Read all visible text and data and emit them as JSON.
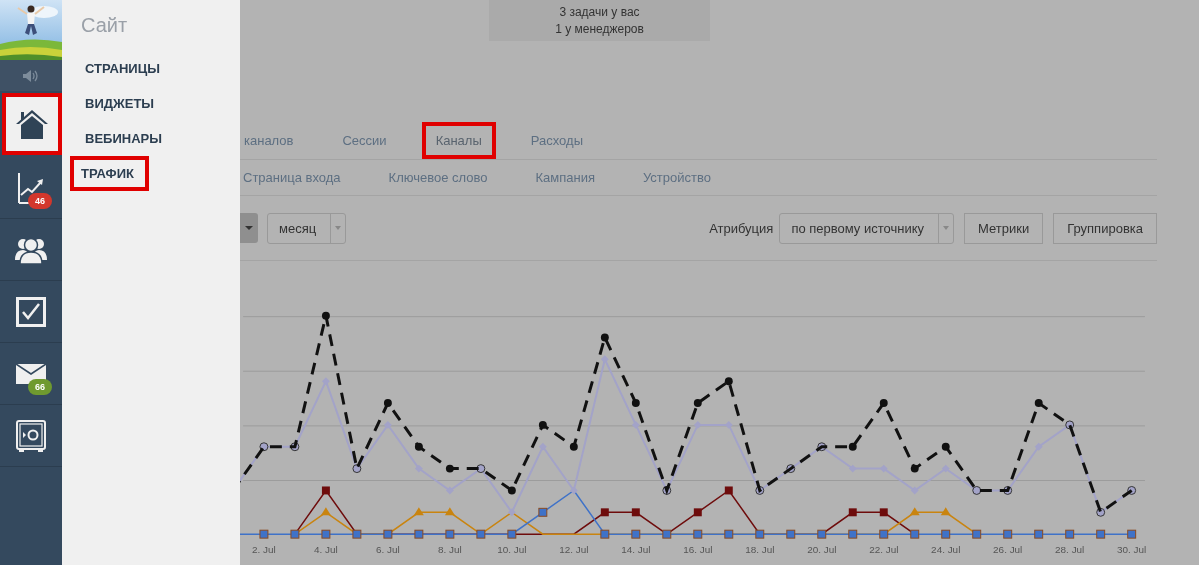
{
  "sidebar": {
    "nav": [
      {
        "kind": "home",
        "highlighted": true
      },
      {
        "kind": "chart",
        "highlighted": false,
        "badge": "46",
        "color": "#d3372c"
      },
      {
        "kind": "people",
        "highlighted": false
      },
      {
        "kind": "tasks",
        "highlighted": false
      },
      {
        "kind": "mail",
        "highlighted": false,
        "badge": "66",
        "color": "#6f9a2f"
      },
      {
        "kind": "safe",
        "highlighted": false
      }
    ]
  },
  "site_menu": {
    "title": "Сайт",
    "items": [
      {
        "label": "СТРАНИЦЫ",
        "highlighted": false
      },
      {
        "label": "ВИДЖЕТЫ",
        "highlighted": false
      },
      {
        "label": "ВЕБИНАРЫ",
        "highlighted": false
      },
      {
        "label": "ТРАФИК",
        "highlighted": true
      }
    ]
  },
  "notice": {
    "lines": [
      "3 задачи у вас",
      "1 у менеджеров"
    ]
  },
  "tabs": [
    {
      "label": "каналов",
      "selected": false,
      "highlighted": false
    },
    {
      "label": "Сессии",
      "selected": false,
      "highlighted": false
    },
    {
      "label": "Каналы",
      "selected": true,
      "highlighted": true
    },
    {
      "label": "Расходы",
      "selected": false,
      "highlighted": false
    }
  ],
  "subtabs": [
    {
      "label": "Страница входа"
    },
    {
      "label": "Ключевое слово"
    },
    {
      "label": "Кампания"
    },
    {
      "label": "Устройство"
    }
  ],
  "toolbar": {
    "period": "месяц",
    "attribution_label": "Атрибуция",
    "attribution": "по первому источнику",
    "buttons": [
      "Метрики",
      "Группировка"
    ]
  },
  "chart": {
    "x_labels": [
      "2. Jul",
      "4. Jul",
      "6. Jul",
      "8. Jul",
      "10. Jul",
      "12. Jul",
      "14. Jul",
      "16. Jul",
      "18. Jul",
      "20. Jul",
      "22. Jul",
      "24. Jul",
      "26. Jul",
      "28. Jul",
      "30. Jul"
    ]
  }
}
